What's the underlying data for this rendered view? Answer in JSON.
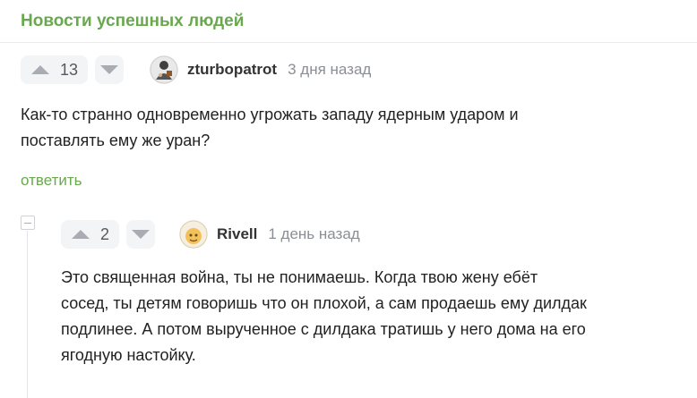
{
  "community": "Новости успешных людей",
  "comment": {
    "rating": "13",
    "author": "zturbopatrot",
    "date": "3 дня назад",
    "lines": [
      "Как-то странно одновременно угрожать западу ядерным ударом и",
      "поставлять ему же уран?"
    ],
    "reply_label": "ответить"
  },
  "reply_comment": {
    "rating": "2",
    "author": "Rivell",
    "date": "1 день назад",
    "lines": [
      "Это священная война, ты не понимаешь. Когда твою жену ебёт",
      "сосед, ты детям говоришь что он плохой, а сам продаешь ему дилдак",
      "подлинее. А потом вырученное с дилдака тратишь у него дома на его",
      "ягодную настойку."
    ]
  },
  "icons": {
    "upvote": "triangle-up-icon",
    "downvote": "triangle-down-icon",
    "collapse": "minus-box-icon"
  },
  "colors": {
    "community": "#6aa84f",
    "reply_link": "#6aa84f",
    "vote_background": "#f3f4f6",
    "vote_arrow": "#a9adb3",
    "date": "#8b8f94"
  }
}
